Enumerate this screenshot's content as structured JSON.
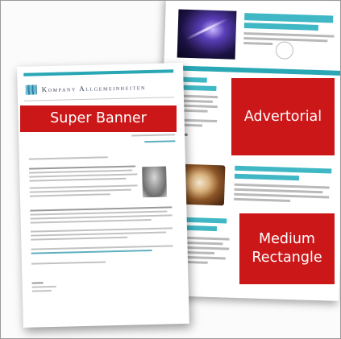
{
  "labels": {
    "super_banner": "Super Banner",
    "advertorial": "Advertorial",
    "medium_rectangle": "Medium\nRectangle"
  },
  "front_page": {
    "masthead": "Kompany Allgemeinheiten"
  },
  "colors": {
    "label_red": "#cc1719",
    "teal": "#2aa7b5",
    "page_border": "#9a9a9a"
  }
}
